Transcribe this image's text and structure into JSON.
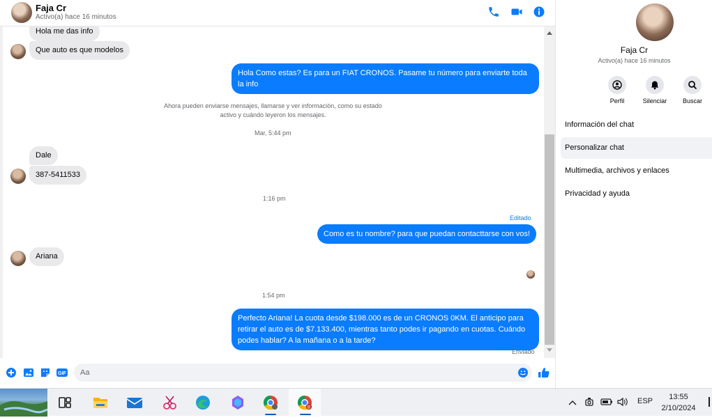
{
  "header": {
    "name": "Faja Cr",
    "status": "Activo(a) hace 16 minutos"
  },
  "messages": {
    "in_1": "Hola me das info",
    "in_2": "Que auto es que modelos",
    "out_1": "Hola Como estas?  Es para un FIAT CRONOS. Pasame tu número para enviarte toda la info",
    "system_note_1": "Ahora pueden enviarse mensajes, llamarse y ver información, como su estado",
    "system_note_2": "activo y cuándo leyeron los mensajes.",
    "ts_1": "Mar, 5:44 pm",
    "in_3": "Dale",
    "in_4": "387-5411533",
    "ts_2": "1:16 pm",
    "edited_label": "Editado",
    "out_2": "Como es tu nombre? para que puedan contacttarse con vos!",
    "in_5": "Ariana",
    "ts_3": "1:54 pm",
    "out_3": "Perfecto Ariana! La cuota desde $198.000 es de un CRONOS 0KM. El anticipo para retirar el auto es de $7.133.400, mientras tanto podes ir pagando en cuotas. Cuándo podes hablar? A la mañana o a la tarde?",
    "sent_label": "Enviado"
  },
  "composer": {
    "placeholder": "Aa"
  },
  "sidebar": {
    "name": "Faja Cr",
    "status": "Activo(a) hace 16 minutos",
    "actions": {
      "profile": "Perfil",
      "mute": "Silenciar",
      "search": "Buscar"
    },
    "items": [
      "Información del chat",
      "Personalizar chat",
      "Multimedia, archivos y enlaces",
      "Privacidad y ayuda"
    ]
  },
  "taskbar": {
    "language": "ESP",
    "time": "13:55",
    "date": "2/10/2024"
  },
  "colors": {
    "accent": "#0a7cff",
    "incoming_bubble": "#e9e9eb"
  }
}
